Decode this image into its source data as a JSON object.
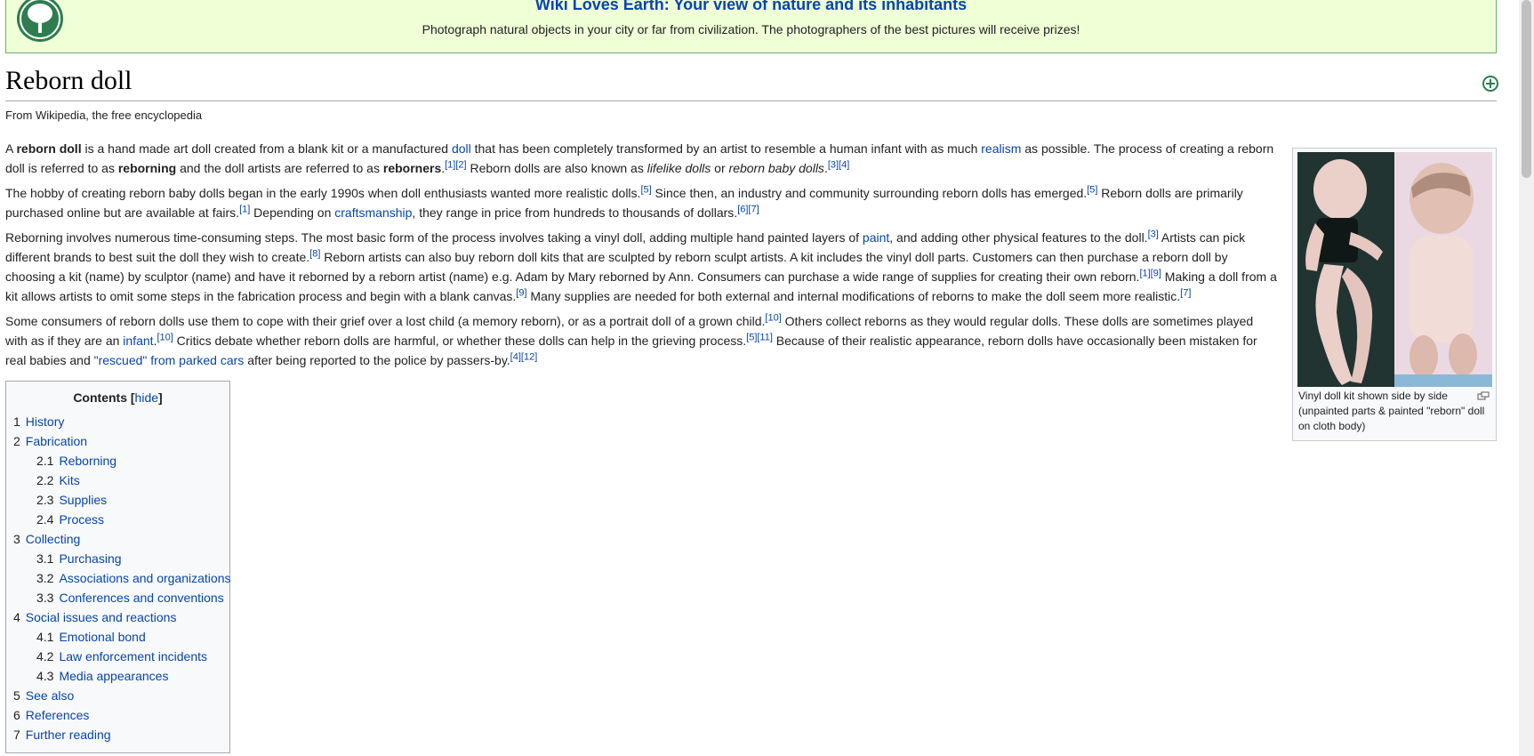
{
  "banner": {
    "title": "Wiki Loves Earth: Your view of nature and its inhabitants",
    "text": "Photograph natural objects in your city or far from civilization. The photographers of the best pictures will receive prizes!"
  },
  "page": {
    "title": "Reborn doll",
    "tagline": "From Wikipedia, the free encyclopedia"
  },
  "paragraphs": {
    "p1": {
      "a": "A ",
      "b1": "reborn doll",
      "c": " is a hand made art doll created from a blank kit or a manufactured ",
      "link_doll": "doll",
      "d": " that has been completely transformed by an artist to resemble a human infant with as much ",
      "link_realism": "realism",
      "e": " as possible. The process of creating a reborn doll is referred to as ",
      "b2": "reborning",
      "f": " and the doll artists are referred to as ",
      "b3": "reborners",
      "g": ".",
      "ref1": "[1][2]",
      "h": " Reborn dolls are also known as ",
      "i1": "lifelike dolls",
      "j": " or ",
      "i2": "reborn baby dolls",
      "k": ".",
      "ref2": "[3][4]"
    },
    "p2": {
      "a": "The hobby of creating reborn baby dolls began in the early 1990s when doll enthusiasts wanted more realistic dolls.",
      "ref1": "[5]",
      "b": " Since then, an industry and community surrounding reborn dolls has emerged.",
      "ref2": "[5]",
      "c": " Reborn dolls are primarily purchased online but are available at fairs.",
      "ref3": "[1]",
      "d": " Depending on ",
      "link_craft": "craftsmanship",
      "e": ", they range in price from hundreds to thousands of dollars.",
      "ref4": "[6][7]"
    },
    "p3": {
      "a": "Reborning involves numerous time-consuming steps. The most basic form of the process involves taking a vinyl doll, adding multiple hand painted layers of ",
      "link_paint": "paint",
      "b": ", and adding other physical features to the doll.",
      "ref1": "[3]",
      "c": " Artists can pick different brands to best suit the doll they wish to create.",
      "ref2": "[8]",
      "d": " Reborn artists can also buy reborn doll kits that are sculpted by reborn sculpt artists. A kit includes the vinyl doll parts. Customers can then purchase a reborn doll by choosing a kit (name) by sculptor (name) and have it reborned by a reborn artist (name) e.g. Adam by Mary reborned by Ann. Consumers can purchase a wide range of supplies for creating their own reborn.",
      "ref3": "[1][9]",
      "e": " Making a doll from a kit allows artists to omit some steps in the fabrication process and begin with a blank canvas.",
      "ref4": "[9]",
      "f": " Many supplies are needed for both external and internal modifications of reborns to make the doll seem more realistic.",
      "ref5": "[7]"
    },
    "p4": {
      "a": "Some consumers of reborn dolls use them to cope with their grief over a lost child (a memory reborn), or as a portrait doll of a grown child.",
      "ref1": "[10]",
      "b": " Others collect reborns as they would regular dolls. These dolls are sometimes played with as if they are an ",
      "link_infant": "infant",
      "c": ".",
      "ref2": "[10]",
      "d": " Critics debate whether reborn dolls are harmful, or whether these dolls can help in the grieving process.",
      "ref3": "[5][11]",
      "e": " Because of their realistic appearance, reborn dolls have occasionally been mistaken for real babies and ",
      "link_rescued": "\"rescued\" from parked cars",
      "f": " after being reported to the police by passers-by.",
      "ref4": "[4][12]"
    }
  },
  "thumb": {
    "caption": "Vinyl doll kit shown side by side (unpainted parts & painted \"reborn\" doll on cloth body)"
  },
  "toc": {
    "title": "Contents",
    "hide_open": "[",
    "hide_label": "hide",
    "hide_close": "]",
    "items": [
      {
        "num": "1",
        "label": "History"
      },
      {
        "num": "2",
        "label": "Fabrication"
      },
      {
        "num": "2.1",
        "label": "Reborning"
      },
      {
        "num": "2.2",
        "label": "Kits"
      },
      {
        "num": "2.3",
        "label": "Supplies"
      },
      {
        "num": "2.4",
        "label": "Process"
      },
      {
        "num": "3",
        "label": "Collecting"
      },
      {
        "num": "3.1",
        "label": "Purchasing"
      },
      {
        "num": "3.2",
        "label": "Associations and organizations"
      },
      {
        "num": "3.3",
        "label": "Conferences and conventions"
      },
      {
        "num": "4",
        "label": "Social issues and reactions"
      },
      {
        "num": "4.1",
        "label": "Emotional bond"
      },
      {
        "num": "4.2",
        "label": "Law enforcement incidents"
      },
      {
        "num": "4.3",
        "label": "Media appearances"
      },
      {
        "num": "5",
        "label": "See also"
      },
      {
        "num": "6",
        "label": "References"
      },
      {
        "num": "7",
        "label": "Further reading"
      }
    ]
  },
  "colors": {
    "link": "#0645ad",
    "banner_bg": "#efffd6",
    "banner_border": "#6ab06a",
    "logo_green": "#2e7d4f"
  },
  "icons": {
    "banner_logo": "tree-logo-icon",
    "expand": "plus-circle-icon",
    "magnify": "enlarge-icon"
  }
}
